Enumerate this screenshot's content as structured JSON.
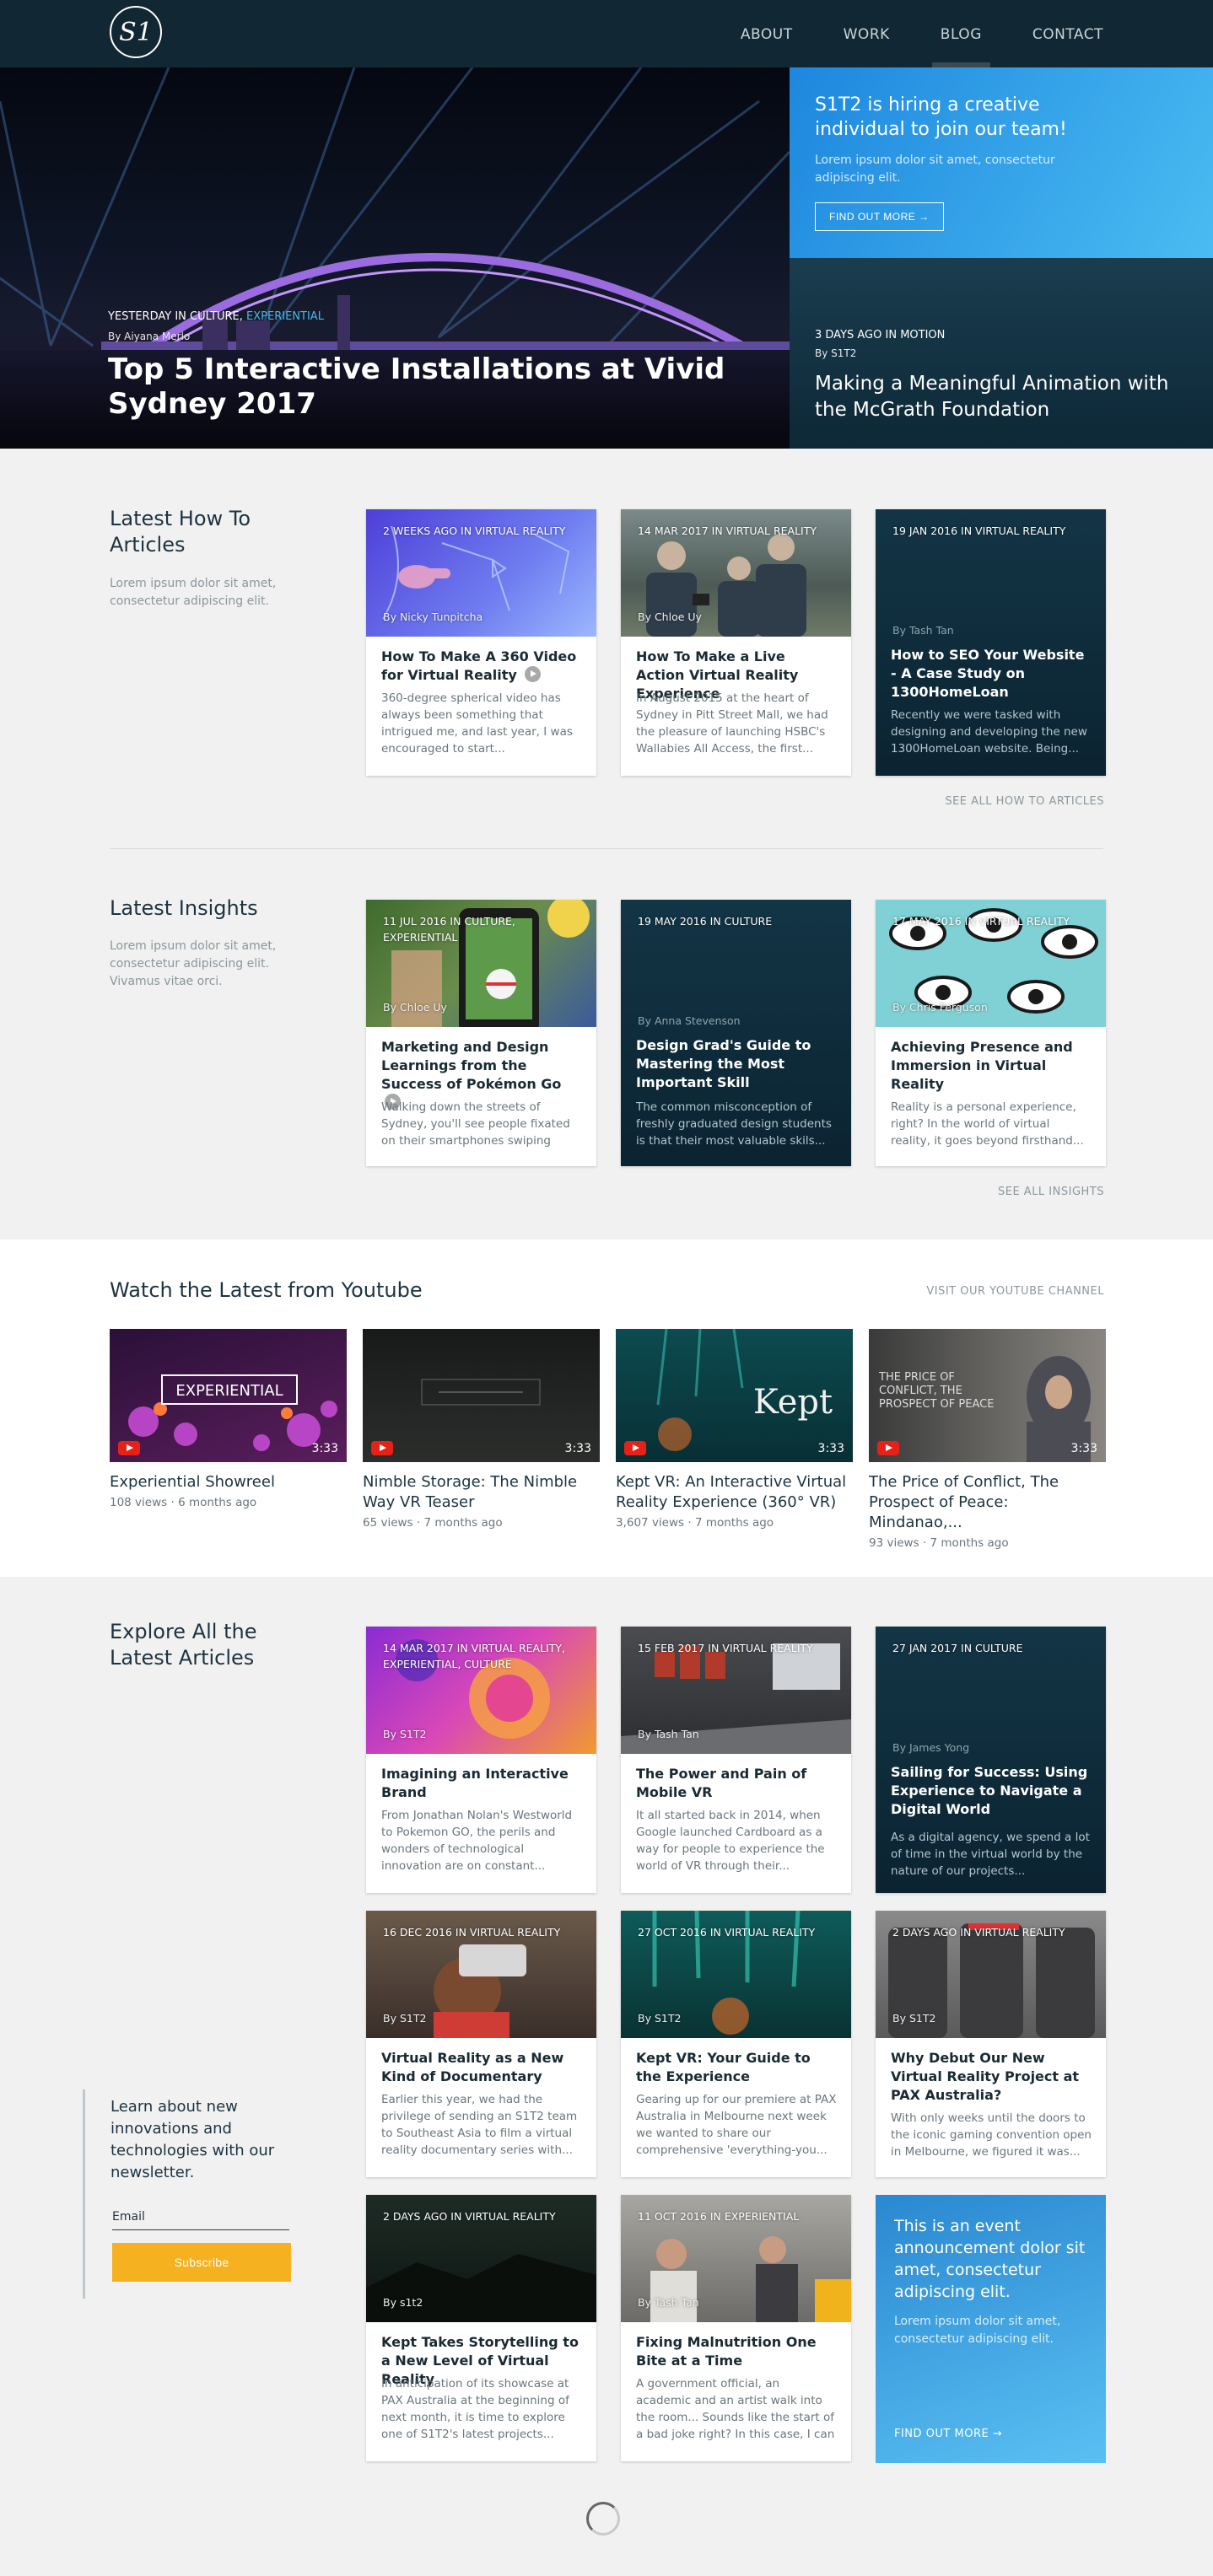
{
  "nav": {
    "logo": "S1",
    "items": [
      "ABOUT",
      "WORK",
      "BLOG",
      "CONTACT"
    ],
    "active": "BLOG"
  },
  "hero": {
    "meta_prefix": "YESTERDAY IN CULTURE,",
    "meta_category": "EXPERIENTIAL",
    "author": "By Aiyana Merlo",
    "title": "Top 5 Interactive Installations at Vivid Sydney 2017"
  },
  "hiring": {
    "title": "S1T2 is hiring a creative individual to join our team!",
    "text": "Lorem ipsum dolor sit amet, consectetur adipiscing elit.",
    "button": "FIND OUT MORE →"
  },
  "motion": {
    "meta": "3 DAYS AGO IN MOTION",
    "author": "By S1T2",
    "title": "Making a Meaningful Animation with the McGrath Foundation"
  },
  "howto": {
    "title": "Latest How To Articles",
    "desc": "Lorem ipsum dolor sit amet, consectetur adipiscing elit.",
    "see_all": "SEE ALL HOW TO ARTICLES",
    "cards": [
      {
        "meta": "2 WEEKS AGO IN VIRTUAL REALITY",
        "author": "By Nicky Tunpitcha",
        "title": "How To Make A 360 Video for Virtual Reality",
        "excerpt": "360-degree spherical video has always been something that intrigued me, and last year, I was encouraged to start..."
      },
      {
        "meta": "14 MAR 2017 IN VIRTUAL REALITY",
        "author": "By Chloe Uy",
        "title": "How To Make a Live Action Virtual Reality Experience",
        "excerpt": "In August 2015 at the heart of Sydney in Pitt Street Mall, we had the pleasure of launching HSBC's Wallabies All Access, the first..."
      },
      {
        "meta": "19 JAN 2016 IN VIRTUAL REALITY",
        "author": "By Tash Tan",
        "title": "How to SEO Your Website - A Case Study on 1300HomeLoan",
        "excerpt": "Recently we were tasked with designing and developing the new 1300HomeLoan website. Being..."
      }
    ]
  },
  "insights": {
    "title": "Latest Insights",
    "desc": "Lorem ipsum dolor sit amet, consectetur adipiscing elit. Vivamus vitae orci.",
    "see_all": "SEE ALL INSIGHTS",
    "cards": [
      {
        "meta": "11 JUL 2016 IN CULTURE, EXPERIENTIAL",
        "author": "By Chloe Uy",
        "title": "Marketing and Design Learnings from the Success of Pokémon Go",
        "excerpt": "Walking down the streets of Sydney, you'll see people fixated on their smartphones swiping their..."
      },
      {
        "meta": "19 MAY 2016 IN CULTURE",
        "author": "By Anna Stevenson",
        "title": "Design Grad's Guide to Mastering the Most Important Skill",
        "excerpt": "The common misconception of freshly graduated design students is that their most valuable skils..."
      },
      {
        "meta": "17 MAY 2016 IN VIRTUAL REALITY",
        "author": "By Chris Ferguson",
        "title": "Achieving Presence and Immersion in Virtual Reality",
        "excerpt": "Reality is a personal experience, right? In the world of virtual reality, it goes beyond firsthand..."
      }
    ]
  },
  "youtube": {
    "title": "Watch the Latest from Youtube",
    "channel_link": "VISIT OUR YOUTUBE CHANNEL",
    "videos": [
      {
        "title": "Experiential Showreel",
        "views": "108 views",
        "age": "6 months ago",
        "duration": "3:33",
        "thumb_text": "EXPERIENTIAL"
      },
      {
        "title": "Nimble Storage: The Nimble Way VR Teaser",
        "views": "65 views",
        "age": "7 months ago",
        "duration": "3:33"
      },
      {
        "title": "Kept VR: An Interactive Virtual Reality Experience (360° VR)",
        "views": "3,607 views",
        "age": "7 months ago",
        "duration": "3:33",
        "thumb_text": "Kept"
      },
      {
        "title": "The Price of Conflict, The Prospect of Peace: Mindanao,...",
        "views": "93 views",
        "age": "7 months ago",
        "duration": "3:33",
        "thumb_text": "THE PRICE OF CONFLICT, THE PROSPECT OF PEACE"
      }
    ]
  },
  "explore": {
    "title": "Explore All the Latest Articles",
    "cards": [
      {
        "meta": "14 MAR 2017 IN VIRTUAL REALITY, EXPERIENTIAL, CULTURE",
        "author": "By S1T2",
        "title": "Imagining an Interactive Brand",
        "excerpt": "From Jonathan Nolan's Westworld to Pokemon GO, the perils and wonders of technological innovation are on constant..."
      },
      {
        "meta": "15 FEB 2017 IN VIRTUAL REALITY",
        "author": "By Tash Tan",
        "title": "The Power and Pain of Mobile VR",
        "excerpt": "It all started back in 2014, when Google launched Cardboard as a way for people to experience the world of VR through their..."
      },
      {
        "meta": "27 JAN 2017 IN CULTURE",
        "author": "By James Yong",
        "title": "Sailing for Success: Using Experience to Navigate a Digital World",
        "excerpt": "As a digital agency, we spend a lot of time in the virtual world by the nature of our projects..."
      },
      {
        "meta": "16 DEC 2016 IN VIRTUAL REALITY",
        "author": "By S1T2",
        "title": "Virtual Reality as a New Kind of Documentary",
        "excerpt": "Earlier this year, we had the privilege of sending an S1T2 team to Southeast Asia to film a virtual reality documentary series with..."
      },
      {
        "meta": "27 OCT 2016 IN VIRTUAL REALITY",
        "author": "By S1T2",
        "title": "Kept VR: Your Guide to the Experience",
        "excerpt": "Gearing up for our premiere at PAX Australia in Melbourne next week we wanted to share our comprehensive 'everything-you..."
      },
      {
        "meta": "2 DAYS AGO IN VIRTUAL REALITY",
        "author": "By S1T2",
        "title": "Why Debut Our New Virtual Reality Project at PAX Australia?",
        "excerpt": "With only weeks until the doors to the iconic gaming convention open in Melbourne, we figured it was..."
      },
      {
        "meta": "2 DAYS AGO IN VIRTUAL REALITY",
        "author": "By s1t2",
        "title": "Kept Takes Storytelling to a New Level of Virtual Reality",
        "excerpt": "In anticipation of its showcase at PAX Australia at the beginning of next month, it is time to explore one of S1T2's latest projects..."
      },
      {
        "meta": "11 OCT 2016 IN EXPERIENTIAL",
        "author": "By Tash Tan",
        "title": "Fixing Malnutrition One Bite at a Time",
        "excerpt": "A government official, an academic and an artist walk into the room... Sounds like the start of a bad joke right? In this case, I can assure..."
      }
    ]
  },
  "newsletter": {
    "title": "Learn about new innovations and technologies with our newsletter.",
    "email_label": "Email",
    "button": "Subscribe"
  },
  "event": {
    "title": "This is an event announcement dolor sit amet, consectetur adipiscing elit.",
    "text": "Lorem ipsum dolor sit amet, consectetur adipiscing elit.",
    "button": "FIND OUT MORE →"
  },
  "colors": {
    "navbar": "#112733",
    "accent_blue": "#2d9be3",
    "subscribe": "#f5b120",
    "dark_card": "#123446"
  }
}
